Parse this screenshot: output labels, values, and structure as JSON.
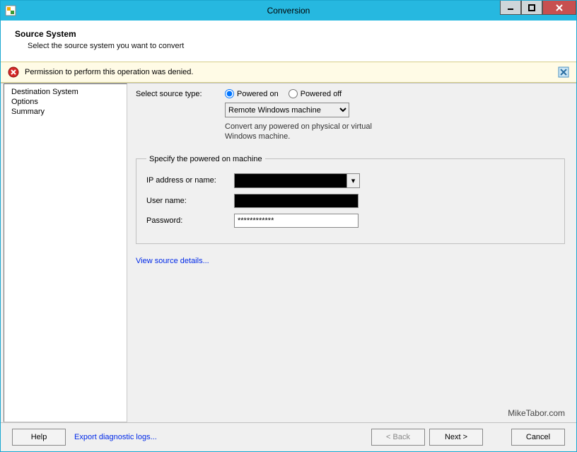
{
  "window": {
    "title": "Conversion"
  },
  "header": {
    "title": "Source System",
    "subtitle": "Select the source system you want to convert"
  },
  "alert": {
    "message": "Permission to perform this operation was denied."
  },
  "sidebar": {
    "items": [
      "Destination System",
      "Options",
      "Summary"
    ]
  },
  "content": {
    "source_type_label": "Select source type:",
    "radio_on": "Powered on",
    "radio_off": "Powered off",
    "machine_type": "Remote Windows machine",
    "hint": "Convert any powered on physical or virtual Windows machine.",
    "group_legend": "Specify the powered on machine",
    "ip_label": "IP address or name:",
    "ip_value": "███████",
    "user_label": "User name:",
    "user_value": "██████",
    "pass_label": "Password:",
    "pass_value": "************",
    "view_details": "View source details..."
  },
  "watermark": "MikeTabor.com",
  "footer": {
    "help": "Help",
    "export": "Export diagnostic logs...",
    "back": "< Back",
    "next": "Next >",
    "cancel": "Cancel"
  }
}
